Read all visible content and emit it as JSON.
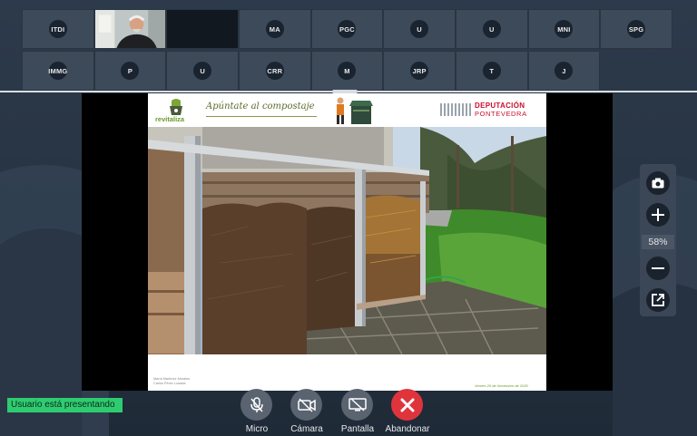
{
  "participants": {
    "row1": [
      "ITDI",
      "",
      "",
      "MA",
      "PGC",
      "U",
      "U",
      "MNI",
      "SPG"
    ],
    "row2": [
      "IMMG",
      "P",
      "U",
      "CRR",
      "M",
      "JRP",
      "T",
      "J"
    ]
  },
  "slide": {
    "logo_text": "revitaliza",
    "title": "Apúntate al compostaje",
    "org_name": "DEPUTACIÓN",
    "org_sub": "PONTEVEDRA",
    "footer_left_1": "María Martínez Morales",
    "footer_left_2": "Carlos Pérez Losada",
    "footer_right": "Venres 20 de Novembro de 2020"
  },
  "zoom": {
    "level": "58%"
  },
  "status": {
    "presenting": "Usuario está presentando"
  },
  "controls": {
    "micro": "Micro",
    "camera": "Cámara",
    "screen": "Pantalla",
    "leave": "Abandonar"
  },
  "colors": {
    "leave": "#e0343c",
    "presenting": "#2ecc71",
    "org": "#c8102e"
  }
}
